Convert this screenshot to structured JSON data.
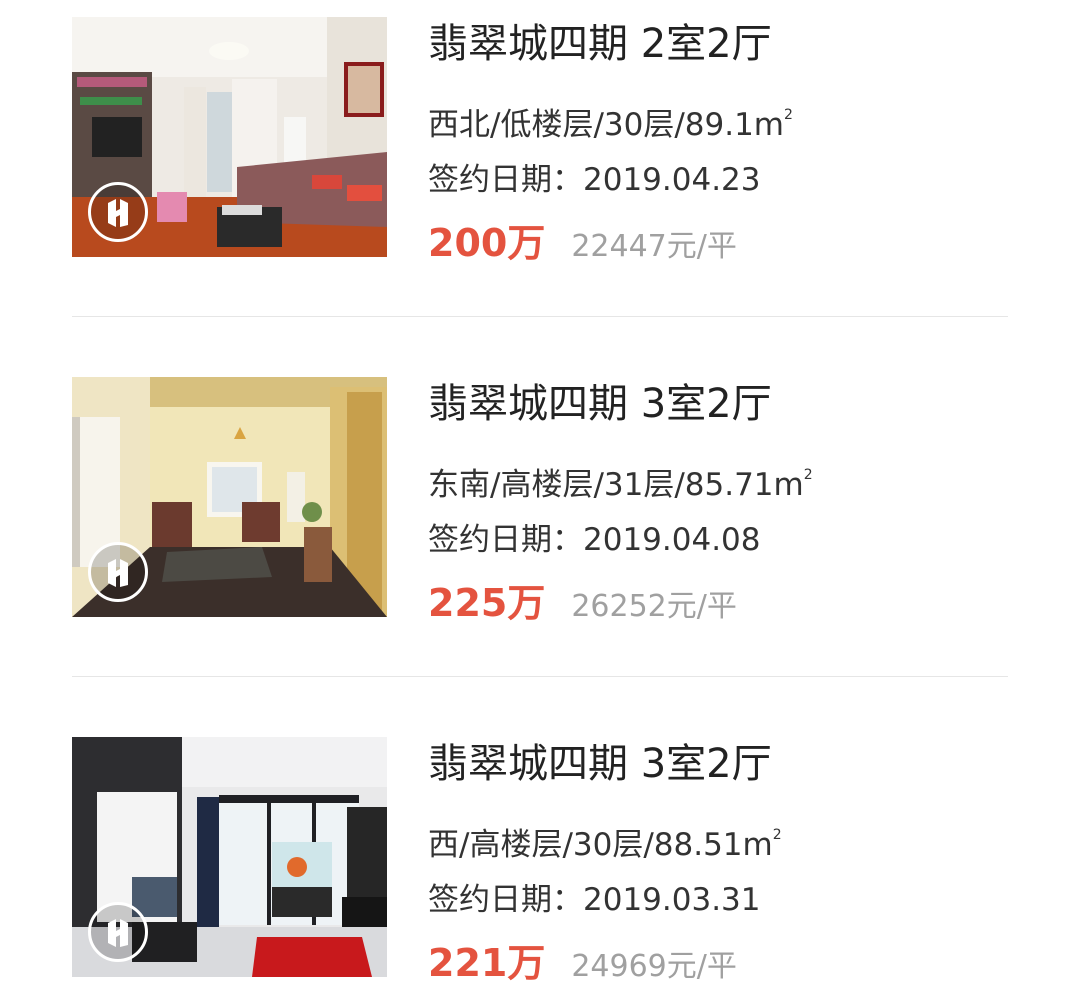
{
  "colors": {
    "price": "#e4533f",
    "unit_price": "#a0a0a0",
    "title": "#222222",
    "divider": "#e6e6e6"
  },
  "listings": [
    {
      "title": "翡翠城四期 2室2厅",
      "specs": "西北/低楼层/30层/89.1m",
      "area_unit_sup": "2",
      "sign_date_label": "签约日期：",
      "sign_date": "2019.04.23",
      "price": "200万",
      "unit_price": "22447元/平",
      "badge_icon": "vr-icon"
    },
    {
      "title": "翡翠城四期 3室2厅",
      "specs": "东南/高楼层/31层/85.71m",
      "area_unit_sup": "2",
      "sign_date_label": "签约日期：",
      "sign_date": "2019.04.08",
      "price": "225万",
      "unit_price": "26252元/平",
      "badge_icon": "vr-icon"
    },
    {
      "title": "翡翠城四期 3室2厅",
      "specs": "西/高楼层/30层/88.51m",
      "area_unit_sup": "2",
      "sign_date_label": "签约日期：",
      "sign_date": "2019.03.31",
      "price": "221万",
      "unit_price": "24969元/平",
      "badge_icon": "vr-icon"
    }
  ]
}
